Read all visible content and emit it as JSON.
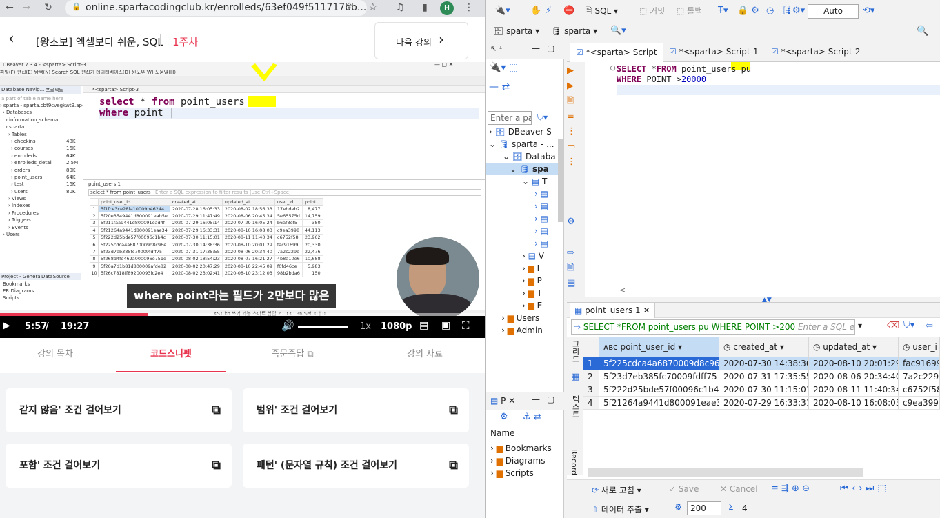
{
  "browser": {
    "url": "online.spartacodingclub.kr/enrolleds/63ef049f511717bb..."
  },
  "lecture": {
    "title": "[왕초보] 엑셀보다 쉬운, SQL",
    "week": "1주차",
    "next": "다음 강의"
  },
  "video": {
    "mini": {
      "window_title": "DBeaver 7.3.4 - <sparta> Script-3",
      "menu": "파일(F)  편집(E)  탐색(N)  Search  SQL 편집기  데이터베이스(D)  윈도우(W)  도움말(H)",
      "nav_title": "Database Navig...",
      "proj_tab": "프로젝트",
      "filter_placeholder": "a part of table name here",
      "editor_tab": "*<sparta> Script-3",
      "tree": [
        "sparta  - sparta.cbt9cvegkwt9.ap-no",
        "Databases",
        "information_schema",
        "sparta",
        "Tables",
        "checkins",
        "courses",
        "enrolleds",
        "enrolleds_detail",
        "orders",
        "point_users",
        "test",
        "users",
        "Views",
        "Indexes",
        "Procedures",
        "Triggers",
        "Events",
        "Users"
      ],
      "tree_sizes": [
        "48K",
        "16K",
        "64K",
        "2.5M",
        "80K",
        "64K",
        "16K",
        "80K"
      ],
      "projects": "Project - General",
      "datasource": "DataSource",
      "proj_items": [
        "Bookmarks",
        "ER Diagrams",
        "Scripts"
      ],
      "code_line1": "select * from point_users",
      "code_line2": "where point ",
      "result_tab": "point_users 1",
      "result_filter": "select * from point_users",
      "result_filter_hint": "Enter a SQL expression to filter results (use Ctrl+Space)",
      "columns": [
        "point_user_id",
        "created_at",
        "updated_at",
        "user_id",
        "point"
      ],
      "rows": [
        [
          "5f1fce3ce28fa10009b46244",
          "2020-07-28 16:05:33",
          "2020-08-02 18:56:33",
          "17ebdeb2",
          "8,477"
        ],
        [
          "5f20e3549441d800091eab5e",
          "2020-07-29 11:47:49",
          "2020-08-06 20:45:34",
          "5e65575d",
          "14,759"
        ],
        [
          "5f211faa9441d800091ead4f",
          "2020-07-29 16:05:14",
          "2020-07-29 16:05:24",
          "b6af3ef5",
          "380"
        ],
        [
          "5f21264a9441d800091eae34",
          "2020-07-29 16:33:31",
          "2020-08-10 16:08:03",
          "c9ea3998",
          "44,113"
        ],
        [
          "5f222d25bde57f00096c1b4c",
          "2020-07-30 11:15:01",
          "2020-08-11 11:40:34",
          "c6752f58",
          "23,962"
        ],
        [
          "5f225cdca4a6870009d8c96e",
          "2020-07-30 14:38:36",
          "2020-08-10 20:01:29",
          "fac91699",
          "20,330"
        ],
        [
          "5f23d7eb385fc70009fdff75",
          "2020-07-31 17:35:55",
          "2020-08-06 20:34:40",
          "7a2c229e",
          "22,476"
        ],
        [
          "5f268d4fe462a000096e751d",
          "2020-08-02 18:54:23",
          "2020-08-07 16:21:27",
          "4b8a10e6",
          "10,688"
        ],
        [
          "5f26a7d1b81d800009afde82",
          "2020-08-02 20:47:29",
          "2020-08-10 22:45:09",
          "f0fd46ce",
          "5,983"
        ],
        [
          "5f26c7818ff89200093fc2e4",
          "2020-08-02 23:02:41",
          "2020-08-10 23:12:03",
          "98b2bda6",
          "150"
        ]
      ],
      "status": "KST   ko   쓰기 가능   스마트 삽입   2 : 13 : 36   Sel: 0 | 0"
    },
    "caption": "where point라는 필드가 2만보다 많은",
    "time_current": "5:57",
    "time_total": "19:27",
    "speed": "1x",
    "quality": "1080p",
    "progress": 0.306
  },
  "tabs": [
    {
      "label": "강의 목차"
    },
    {
      "label": "코드스니펫"
    },
    {
      "label": "즉문즉답"
    },
    {
      "label": "강의 자료"
    }
  ],
  "snippets": [
    {
      "label": "같지 않음' 조건 걸어보기"
    },
    {
      "label": "범위' 조건 걸어보기"
    },
    {
      "label": "포함' 조건 걸어보기"
    },
    {
      "label": "패턴' (문자열 규칙) 조건 걸어보기"
    }
  ],
  "dbeaver": {
    "toolbar": {
      "sql": "SQL",
      "commit": "커밋",
      "rollback": "롤백",
      "auto": "Auto"
    },
    "context": {
      "conn": "sparta",
      "schema": "sparta"
    },
    "editor_tabs": [
      "*<sparta> Script",
      "*<sparta> Script-1",
      "*<sparta> Script-2"
    ],
    "sql_line1": "SELECT *FROM point_users pu",
    "sql_line2": "WHERE POINT >20000",
    "nav": {
      "filter_placeholder": "Enter a par",
      "items": [
        "DBeaver S",
        "sparta - ...",
        "Databa",
        "spa",
        "T",
        "V",
        "I",
        "P",
        "T",
        "E",
        "Users",
        "Admin"
      ]
    },
    "projects": {
      "tab": "P",
      "name_header": "Name",
      "items": [
        "Bookmarks",
        "Diagrams",
        "Scripts"
      ]
    },
    "results": {
      "tab": "point_users 1",
      "filter_query": "SELECT *FROM point_users pu WHERE POINT >200",
      "filter_hint": "Enter a SQL ex",
      "side_labels": {
        "grid": "그리드",
        "text": "텍스트",
        "record": "Record"
      },
      "columns": [
        "point_user_id",
        "created_at",
        "updated_at",
        "user_i"
      ],
      "rows": [
        [
          "1",
          "5f225cdca4a6870009d8c96e",
          "2020-07-30 14:38:36",
          "2020-08-10 20:01:29",
          "fac91699"
        ],
        [
          "2",
          "5f23d7eb385fc70009fdff75",
          "2020-07-31 17:35:55",
          "2020-08-06 20:34:40",
          "7a2c229e"
        ],
        [
          "3",
          "5f222d25bde57f00096c1b4c",
          "2020-07-30 11:15:01",
          "2020-08-11 11:40:34",
          "c6752f58"
        ],
        [
          "4",
          "5f21264a9441d800091eae34",
          "2020-07-29 16:33:31",
          "2020-08-10 16:08:03",
          "c9ea3998"
        ]
      ],
      "bottom": {
        "refresh": "새로 고침",
        "save": "Save",
        "cancel": "Cancel",
        "export": "데이터 추출",
        "fetch_size": "200",
        "count": "4"
      }
    }
  },
  "colors": {
    "brand": "#e8344e",
    "highlight": "#ffff00",
    "sql_keyword": "#7f0055",
    "selection": "#c5dcf5"
  }
}
